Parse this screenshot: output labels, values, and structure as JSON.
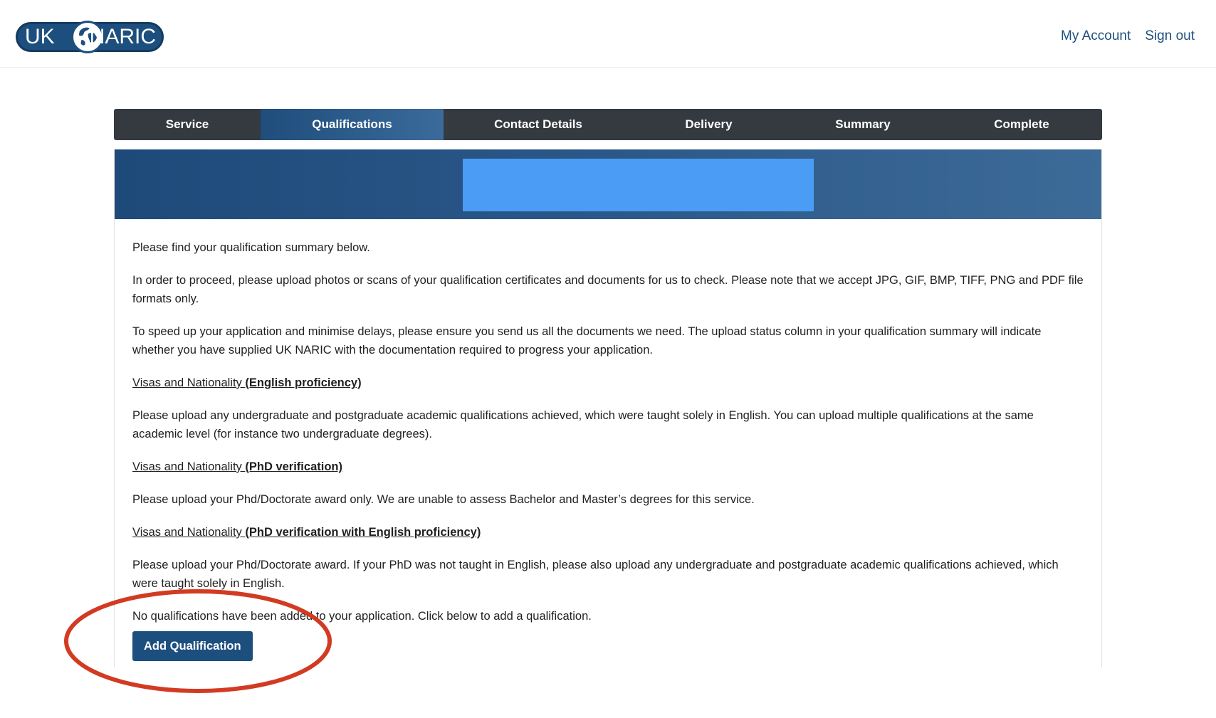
{
  "header": {
    "logo_left": "UK",
    "logo_right": "NARIC",
    "links": [
      "My Account",
      "Sign out"
    ]
  },
  "steps": [
    {
      "label": "Service",
      "active": false
    },
    {
      "label": "Qualifications",
      "active": true
    },
    {
      "label": "Contact Details",
      "active": false
    },
    {
      "label": "Delivery",
      "active": false
    },
    {
      "label": "Summary",
      "active": false
    },
    {
      "label": "Complete",
      "active": false
    }
  ],
  "content": {
    "intro": "Please find your qualification summary below.",
    "upload_info": "In order to proceed, please upload photos or scans of your qualification certificates and documents for us to check. Please note that we accept JPG, GIF, BMP, TIFF, PNG and PDF file formats only.",
    "speed_info": "To speed up your application and minimise delays, please ensure you send us all the documents we need. The upload status column in your qualification summary will indicate whether you have supplied UK NARIC with the documentation required to progress your application.",
    "section1": {
      "prefix": "Visas and Nationality ",
      "bold": "(English proficiency)",
      "text": "Please upload any undergraduate and postgraduate academic qualifications achieved, which were taught solely in English. You can upload multiple qualifications at the same academic level (for instance two undergraduate degrees)."
    },
    "section2": {
      "prefix": "Visas and Nationality ",
      "bold": "(PhD verification)",
      "text": "Please upload your Phd/Doctorate award only. We are unable to assess Bachelor and Master’s degrees for this service."
    },
    "section3": {
      "prefix": "Visas and Nationality ",
      "bold": "(PhD verification with English proficiency)",
      "text": "Please upload your Phd/Doctorate award. If your PhD was not taught in English, please also upload any undergraduate and postgraduate academic qualifications achieved, which were taught solely in English."
    },
    "no_quals": "No qualifications have been added to your application. Click below to add a qualification.",
    "add_button": "Add Qualification"
  },
  "colors": {
    "brand": "#1d4f7e",
    "nav_bg": "#343a40",
    "banner_block": "#4a9cf5",
    "annotation": "#d23b22"
  }
}
